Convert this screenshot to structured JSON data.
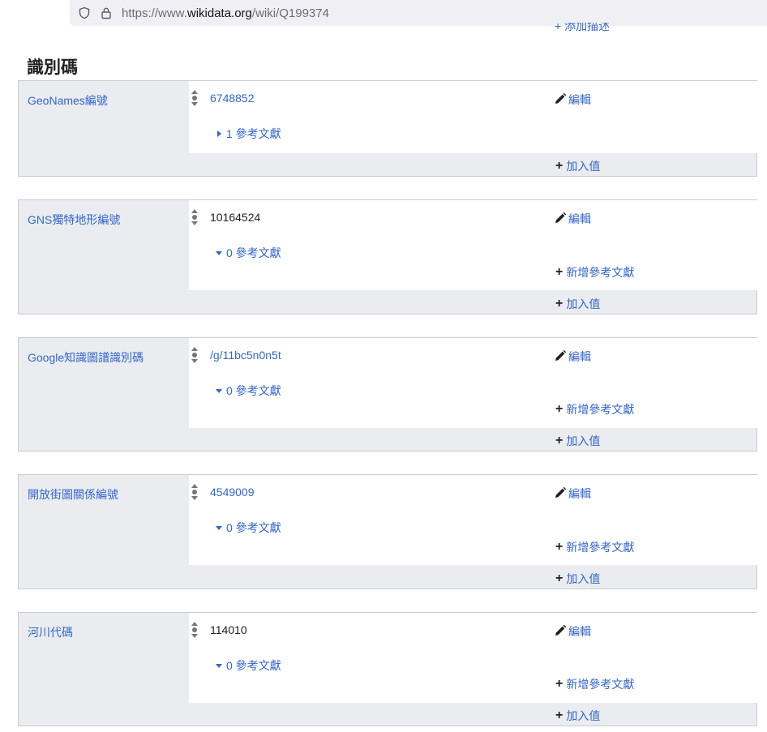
{
  "browser": {
    "url_prefix": "https://www.",
    "url_domain": "wikidata.org",
    "url_path": "/wiki/Q199374"
  },
  "prev_section": {
    "link_label": "+ 添加描述"
  },
  "section": {
    "title": "識別碼"
  },
  "labels": {
    "edit": "編輯",
    "add_value": "加入值",
    "add_reference": "新增參考文獻"
  },
  "groups": [
    {
      "property": "GeoNames編號",
      "value": "6748852",
      "refs": "1 參考文獻",
      "refs_expanded": false
    },
    {
      "property": "GNS獨特地形編號",
      "value": "10164524",
      "refs": "0 參考文獻",
      "refs_expanded": true
    },
    {
      "property": "Google知識圖譜識別碼",
      "value": "/g/11bc5n0n5t",
      "refs": "0 參考文獻",
      "refs_expanded": true
    },
    {
      "property": "開放街圖關係編號",
      "value": "4549009",
      "refs": "0 參考文獻",
      "refs_expanded": true
    },
    {
      "property": "河川代碼",
      "value": "114010",
      "refs": "0 參考文獻",
      "refs_expanded": true
    }
  ],
  "colors": {
    "link": "#3366cc",
    "text": "#202122",
    "group_bg": "#eaecf0",
    "border": "#c8ccd1"
  }
}
